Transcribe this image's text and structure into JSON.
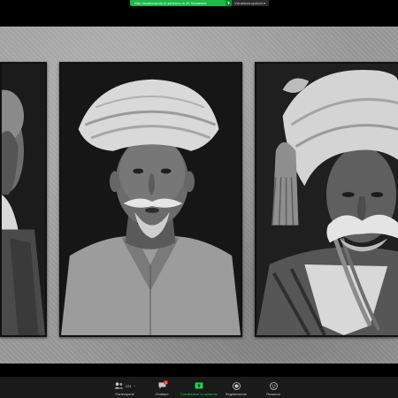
{
  "banner": {
    "share_text": "Stai visualizzando lo schermo di JK Schneider",
    "stop_glyph": "▾",
    "view_options": "Visualizza opzioni ▾"
  },
  "toolbar": {
    "participants": {
      "label": "Partecipanti",
      "count": "124",
      "icon": "participants-icon"
    },
    "chat": {
      "label": "Chattare",
      "badge": "1",
      "icon": "chat-icon"
    },
    "share": {
      "label": "Condividere lo schermo",
      "icon": "share-screen-icon"
    },
    "record": {
      "label": "Registrazione",
      "icon": "record-icon"
    },
    "reactions": {
      "label": "Reazioni",
      "icon": "reactions-icon"
    }
  },
  "colors": {
    "accent_green": "#21b74a",
    "badge_red": "#e0322e",
    "toolbar_bg": "#1a1a1a"
  }
}
